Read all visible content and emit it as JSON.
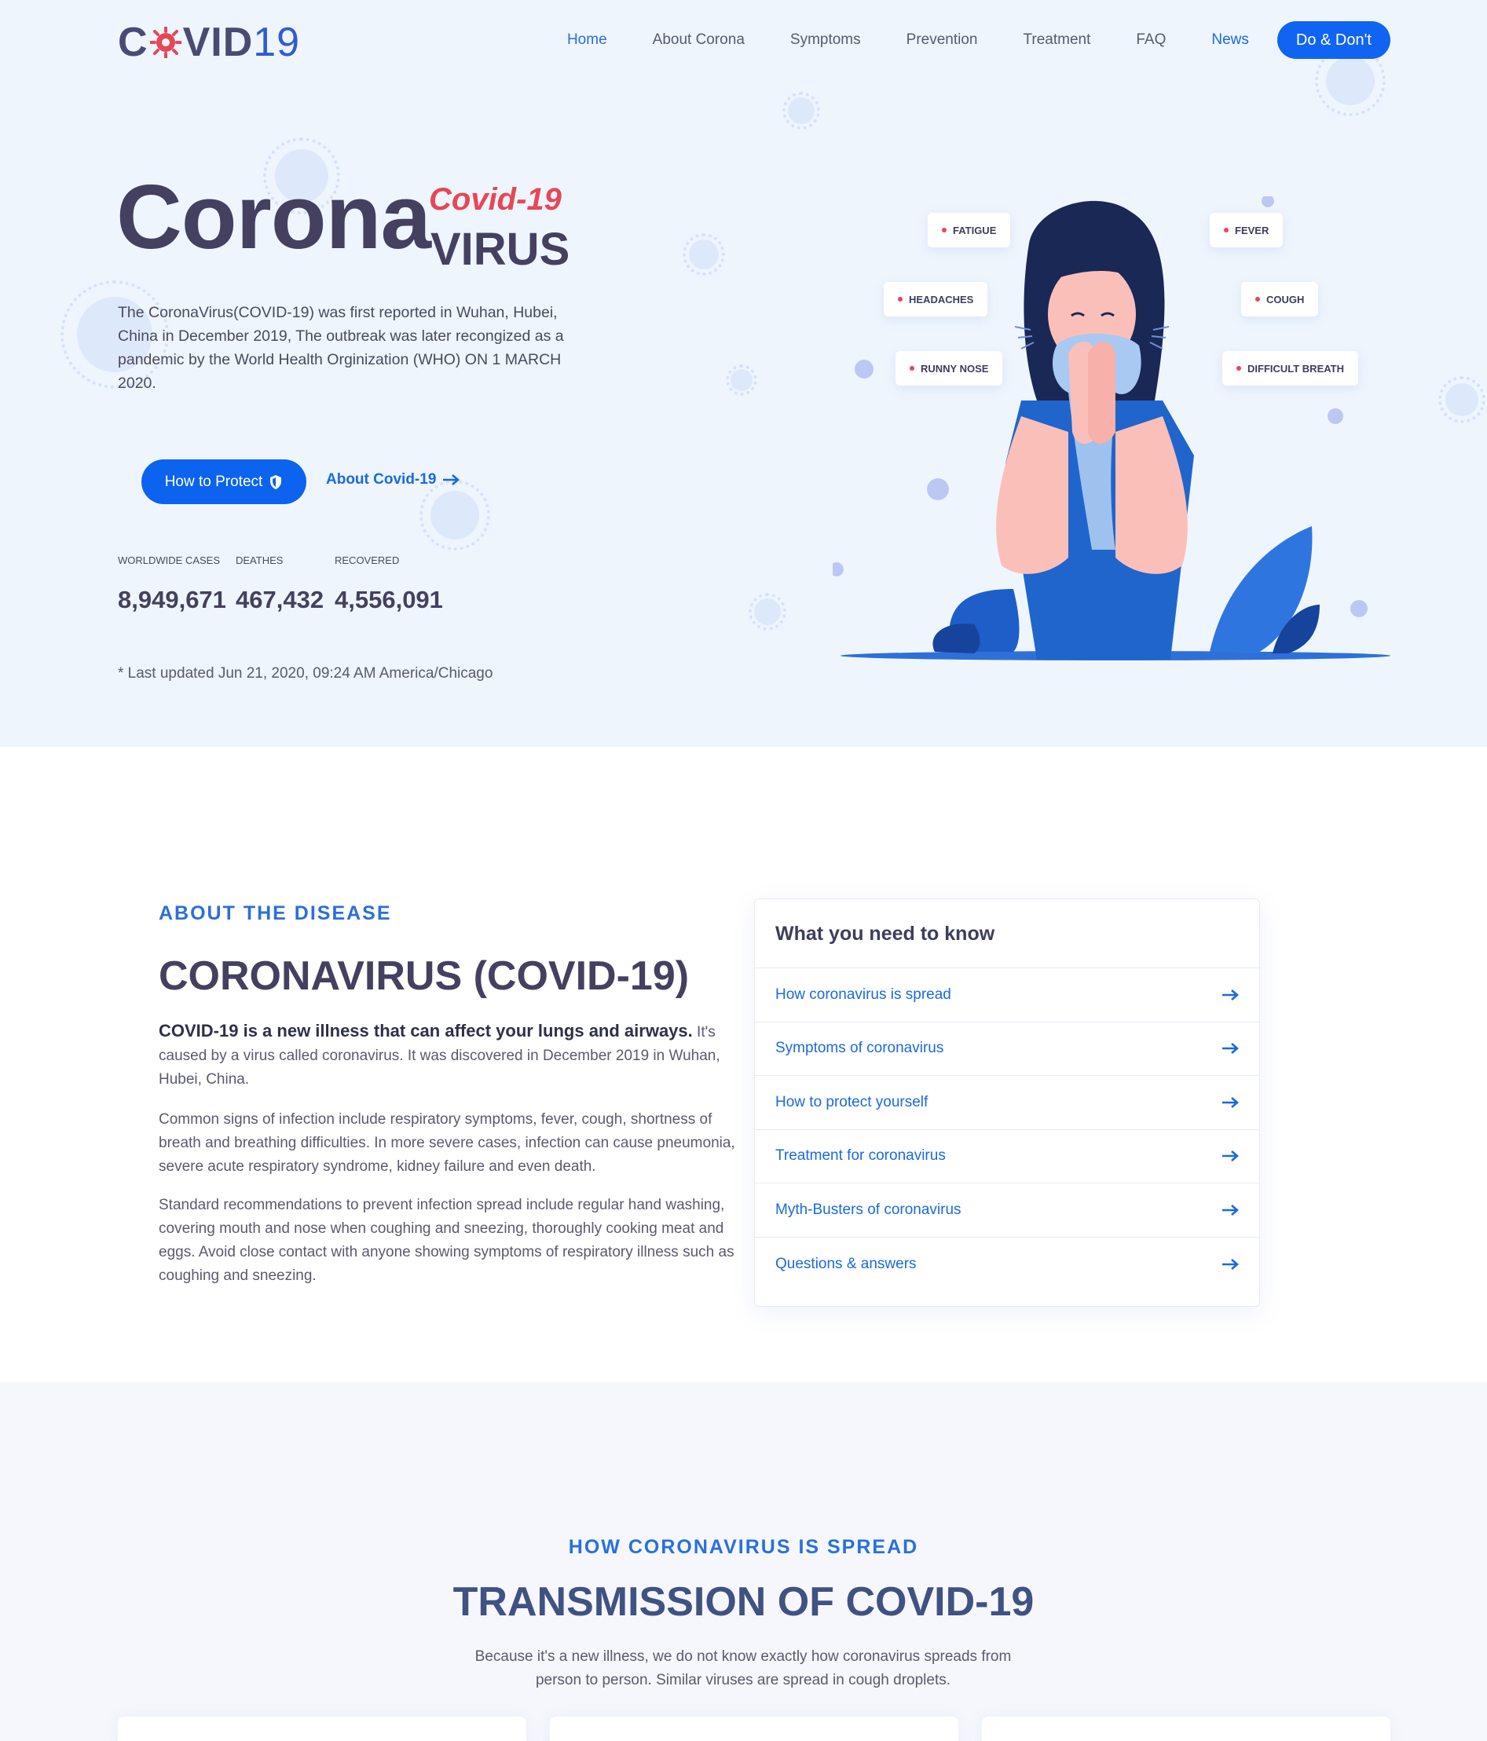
{
  "nav": {
    "logo_left": "C",
    "logo_mid": "VID",
    "logo_num": "19",
    "items": [
      "Home",
      "About Corona",
      "Symptoms",
      "Prevention",
      "Treatment",
      "FAQ",
      "News"
    ],
    "cta": "Do & Don't"
  },
  "hero": {
    "title": "Corona",
    "covid": "Covid-19",
    "virus": "VIRUS",
    "desc": "The CoronaVirus(COVID-19) was first reported in Wuhan, Hubei, China in December 2019, The outbreak was later recongized as a pandemic by the World Health Orginization (WHO) ON 1 MARCH 2020.",
    "btn_protect": "How to Protect",
    "link_about": "About Covid-19",
    "stats": [
      {
        "label": "WORLDWIDE CASES",
        "value": "8,949,671"
      },
      {
        "label": "DEATHES",
        "value": "467,432"
      },
      {
        "label": "RECOVERED",
        "value": "4,556,091"
      }
    ],
    "updated": "* Last updated Jun 21, 2020, 09:24 AM America/Chicago",
    "symptoms": [
      "FATIGUE",
      "FEVER",
      "HEADACHES",
      "COUGH",
      "RUNNY NOSE",
      "DIFFICULT BREATH"
    ]
  },
  "about": {
    "eyebrow": "ABOUT THE DISEASE",
    "title": "CORONAVIRUS (COVID-19)",
    "lead_bold": "COVID-19 is a new illness that can affect your lungs and airways.",
    "lead_rest": " It's caused by a virus called coronavirus. It was discovered in December 2019 in Wuhan, Hubei, China.",
    "p2": "Common signs of infection include respiratory symptoms, fever, cough, shortness of breath and breathing difficulties. In more severe cases, infection can cause pneumonia, severe acute respiratory syndrome, kidney failure and even death.",
    "p3": "Standard recommendations to prevent infection spread include regular hand washing, covering mouth and nose when coughing and sneezing, thoroughly cooking meat and eggs. Avoid close contact with anyone showing symptoms of respiratory illness such as coughing and sneezing.",
    "card_title": "What you need to know",
    "card_items": [
      "How coronavirus is spread",
      "Symptoms of coronavirus",
      "How to protect yourself",
      "Treatment for coronavirus",
      "Myth-Busters of coronavirus",
      "Questions & answers"
    ]
  },
  "spread": {
    "eyebrow": "HOW CORONAVIRUS IS SPREAD",
    "title": "TRANSMISSION OF COVID-19",
    "desc": "Because it's a new illness, we do not know exactly how coronavirus spreads from person to person. Similar viruses are spread in cough droplets."
  },
  "colors": {
    "accent": "#1164f2",
    "title": "#44405f",
    "alert": "#e64757",
    "hero_bg": "#eef5fd"
  }
}
